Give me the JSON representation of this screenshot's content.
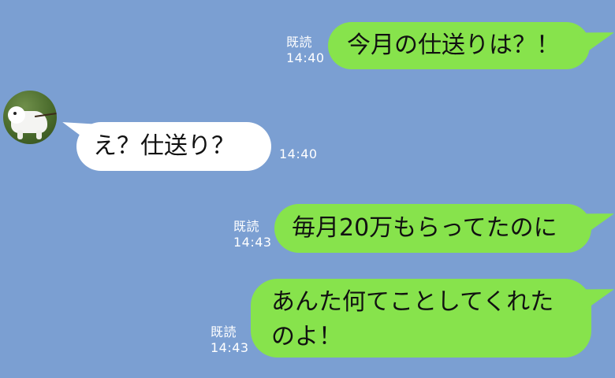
{
  "messages": [
    {
      "side": "out",
      "text_lines": [
        "今月の仕送りは？！"
      ],
      "read_label": "既読",
      "time": "14:40"
    },
    {
      "side": "in",
      "text_lines": [
        "え？仕送り？"
      ],
      "time": "14:40",
      "avatar": "white-dog-photo"
    },
    {
      "side": "out",
      "text_lines": [
        "毎月20万もらってたのに"
      ],
      "read_label": "既読",
      "time": "14:43"
    },
    {
      "side": "out",
      "text_lines": [
        "あんた何てことしてくれた",
        "のよ！"
      ],
      "read_label": "既読",
      "time": "14:43"
    }
  ],
  "colors": {
    "background": "#7b9fd2",
    "outgoing_bubble": "#87e34c",
    "incoming_bubble": "#ffffff",
    "meta_text": "#ffffff"
  }
}
